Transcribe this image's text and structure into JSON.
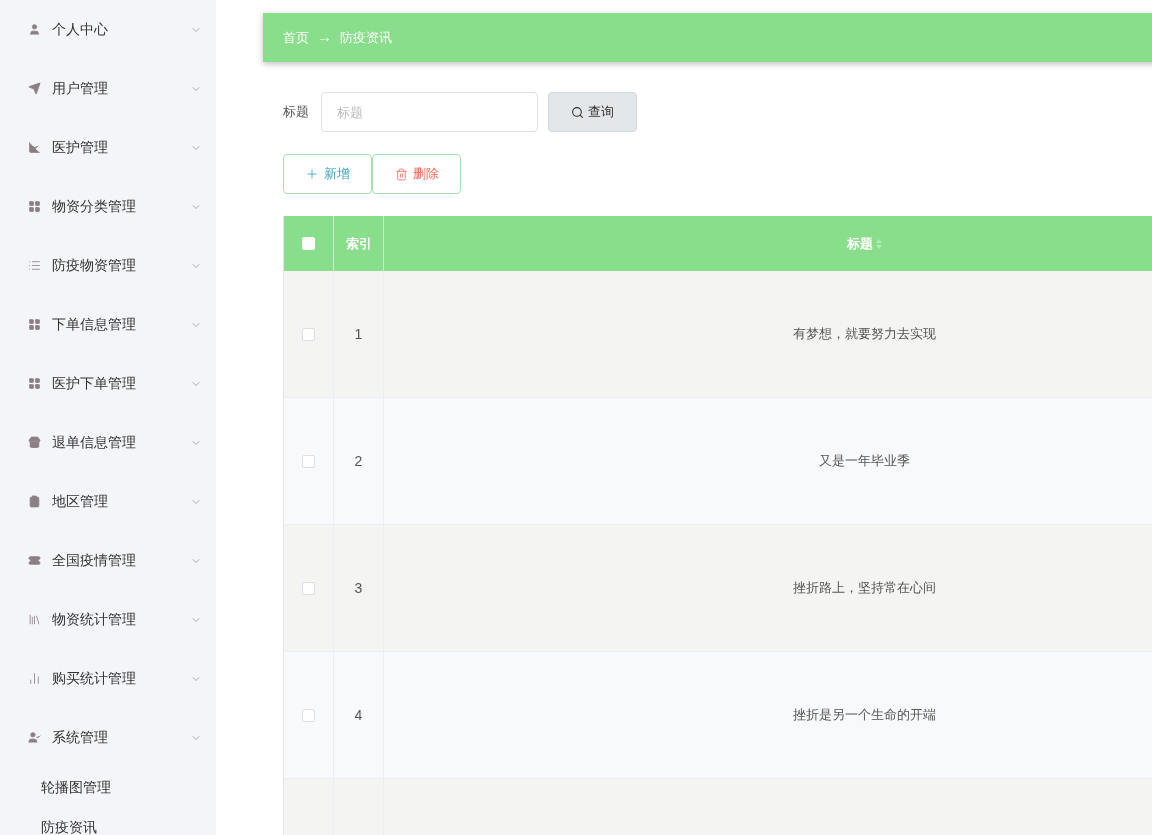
{
  "sidebar": {
    "items": [
      {
        "label": "个人中心"
      },
      {
        "label": "用户管理"
      },
      {
        "label": "医护管理"
      },
      {
        "label": "物资分类管理"
      },
      {
        "label": "防疫物资管理"
      },
      {
        "label": "下单信息管理"
      },
      {
        "label": "医护下单管理"
      },
      {
        "label": "退单信息管理"
      },
      {
        "label": "地区管理"
      },
      {
        "label": "全国疫情管理"
      },
      {
        "label": "物资统计管理"
      },
      {
        "label": "购买统计管理"
      },
      {
        "label": "系统管理",
        "children": [
          {
            "label": "轮播图管理"
          },
          {
            "label": "防疫资讯"
          }
        ]
      }
    ]
  },
  "breadcrumb": {
    "home": "首页",
    "separator": "→",
    "current": "防疫资讯"
  },
  "search": {
    "label": "标题",
    "placeholder": "标题",
    "button": "查询"
  },
  "actions": {
    "add": "新增",
    "delete": "删除"
  },
  "table": {
    "header_checked": false,
    "columns": [
      "索引",
      "标题"
    ],
    "rows": [
      {
        "checked": false,
        "index": "1",
        "title": "有梦想，就要努力去实现"
      },
      {
        "checked": false,
        "index": "2",
        "title": "又是一年毕业季"
      },
      {
        "checked": false,
        "index": "3",
        "title": "挫折路上，坚持常在心间"
      },
      {
        "checked": false,
        "index": "4",
        "title": "挫折是另一个生命的开端"
      }
    ]
  }
}
